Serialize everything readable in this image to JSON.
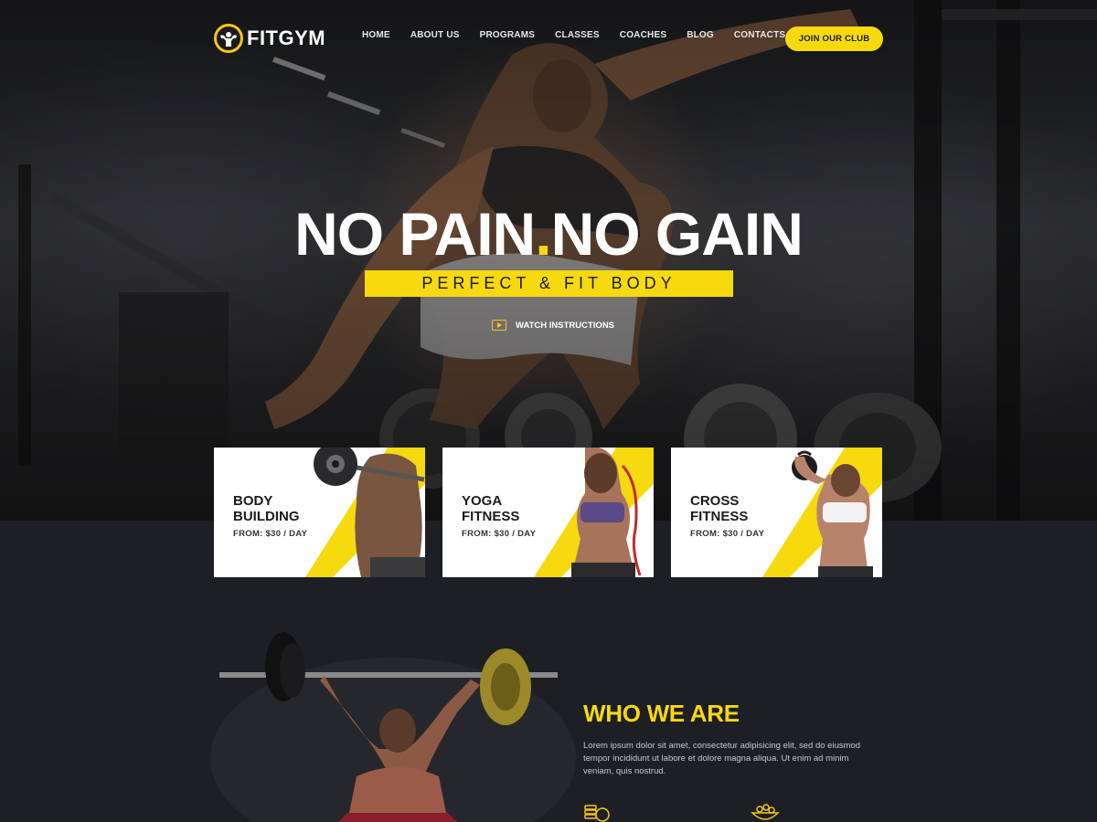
{
  "nav": {
    "logo_text": "FITGYM",
    "items": [
      "HOME",
      "ABOUT US",
      "PROGRAMS",
      "CLASSES",
      "COACHES",
      "BLOG",
      "CONTACTS"
    ],
    "cta": "JOIN OUR CLUB"
  },
  "hero": {
    "title_part1": "NO PAIN",
    "title_dot": ".",
    "title_part2": "NO GAIN",
    "subtitle": "PERFECT & FIT BODY",
    "watch_label": "WATCH INSTRUCTIONS"
  },
  "programs": [
    {
      "title_line1": "BODY",
      "title_line2": "BUILDING",
      "price": "FROM: $30 / DAY",
      "icon": "barbell-athlete"
    },
    {
      "title_line1": "YOGA",
      "title_line2": "FITNESS",
      "price": "FROM: $30 / DAY",
      "icon": "yoga-athlete"
    },
    {
      "title_line1": "CROSS",
      "title_line2": "FITNESS",
      "price": "FROM: $30 / DAY",
      "icon": "kettlebell-athlete"
    }
  ],
  "about": {
    "title": "WHO WE ARE",
    "text": "Lorem ipsum dolor sit amet, consectetur adipisicing elit, sed do eiusmod tempor incididunt ut labore et dolore magna aliqua. Ut enim ad minim veniam, quis nostrud.",
    "icons": [
      "coins-icon",
      "food-bowl-icon"
    ]
  },
  "colors": {
    "accent": "#f7d90f",
    "dark": "#1e1f24",
    "white": "#ffffff"
  }
}
